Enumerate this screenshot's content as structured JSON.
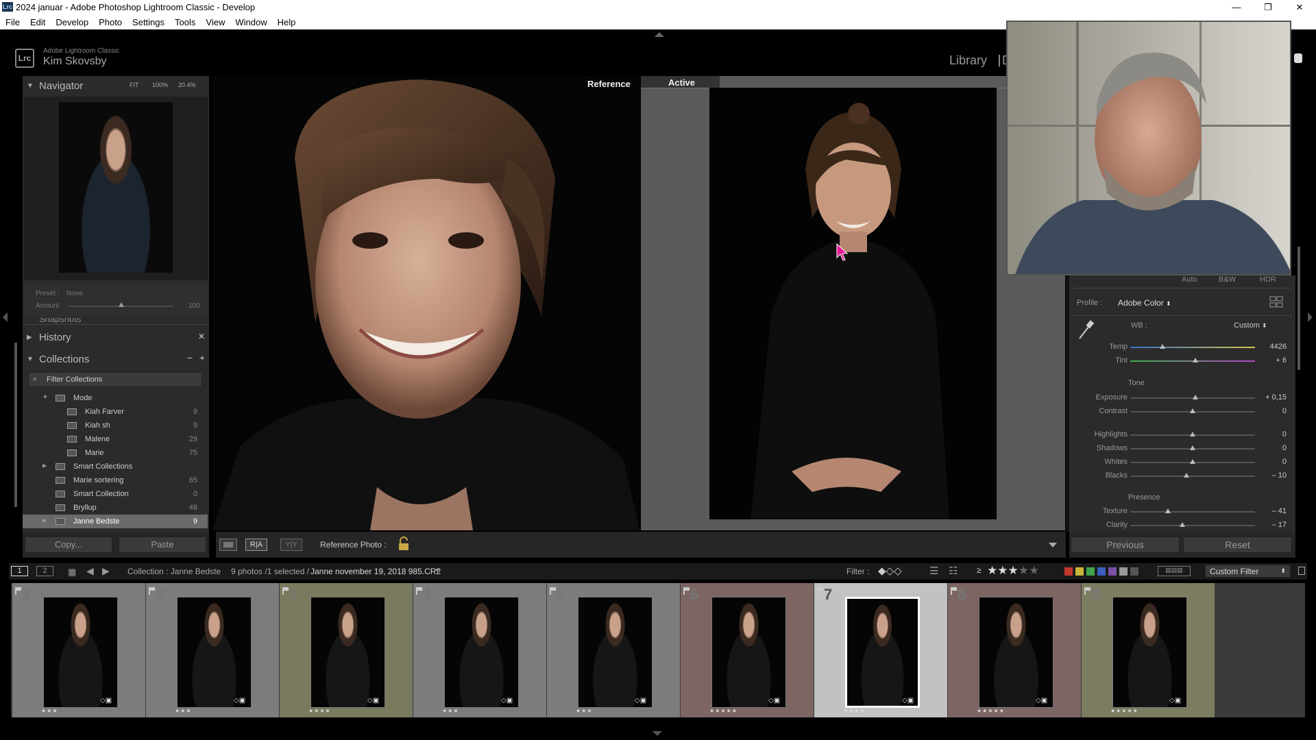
{
  "window": {
    "title": "2024 januar - Adobe Photoshop Lightroom Classic - Develop",
    "app_icon": "Lrc"
  },
  "menu": [
    "File",
    "Edit",
    "Develop",
    "Photo",
    "Settings",
    "Tools",
    "View",
    "Window",
    "Help"
  ],
  "identity": {
    "product": "Adobe Lightroom Classic",
    "user": "Kim Skovsby",
    "logo": "Lrc",
    "module": "Library",
    "module_partial": "D"
  },
  "navigator": {
    "title": "Navigator",
    "fit": "FIT",
    "zoom1": "100%",
    "zoom2": "20.4%"
  },
  "preset": {
    "label": "Preset :",
    "value": "None",
    "amount_label": "Amount",
    "amount_value": "100",
    "amount_fraction": 0.5
  },
  "panels": {
    "snapshots": "Snapshots",
    "history": "History",
    "collections": "Collections"
  },
  "collections": {
    "filter": "Filter Collections",
    "items": [
      {
        "name": "Mode",
        "count": ""
      },
      {
        "name": "Kiah Farver",
        "count": "9"
      },
      {
        "name": "Kiah sh",
        "count": "9"
      },
      {
        "name": "Malene",
        "count": "29"
      },
      {
        "name": "Marie",
        "count": "75"
      },
      {
        "name": "Smart Collections",
        "count": ""
      },
      {
        "name": "Marie sortering",
        "count": "65"
      },
      {
        "name": "Smart Collection",
        "count": "0"
      },
      {
        "name": "Bryllup",
        "count": "48"
      },
      {
        "name": "Janne Bedste",
        "count": "9"
      }
    ]
  },
  "left_buttons": {
    "copy": "Copy...",
    "paste": "Paste"
  },
  "compare": {
    "reference_label": "Reference",
    "active_label": "Active",
    "reference_photo": "Reference Photo :",
    "view_ra": "R|A",
    "view_yy": "Y|Y"
  },
  "basic": {
    "tabs": [
      "Auto",
      "B&W",
      "HDR"
    ],
    "profile_label": "Profile :",
    "profile_value": "Adobe Color",
    "wb_label": "WB :",
    "wb_value": "Custom",
    "tone_label": "Tone",
    "presence_label": "Presence",
    "sliders": [
      {
        "label": "Temp",
        "value": "4426",
        "fraction": 0.26
      },
      {
        "label": "Tint",
        "value": "+ 6",
        "fraction": 0.52
      },
      {
        "label": "Exposure",
        "value": "+ 0,15",
        "fraction": 0.52
      },
      {
        "label": "Contrast",
        "value": "0",
        "fraction": 0.5
      },
      {
        "label": "Highlights",
        "value": "0",
        "fraction": 0.5
      },
      {
        "label": "Shadows",
        "value": "0",
        "fraction": 0.5
      },
      {
        "label": "Whites",
        "value": "0",
        "fraction": 0.5
      },
      {
        "label": "Blacks",
        "value": "– 10",
        "fraction": 0.45
      },
      {
        "label": "Texture",
        "value": "– 41",
        "fraction": 0.3
      },
      {
        "label": "Clarity",
        "value": "– 17",
        "fraction": 0.42
      }
    ],
    "previous": "Previous",
    "reset": "Reset"
  },
  "filmbar": {
    "page1": "1",
    "page2": "2",
    "source": "Collection : Janne Bedste",
    "count": "9 photos /1 selected /",
    "file": "Janne november 19, 2018 985.CR2",
    "filter_label": "Filter :",
    "rating_op": "≥",
    "rating_stars": 3,
    "custom_filter": "Custom Filter"
  },
  "label_colors": [
    "#c0392b",
    "#c9b43a",
    "#3fa34d",
    "#3a5fbf",
    "#7b4fa8",
    "#999999",
    "#555555"
  ],
  "filmstrip": [
    {
      "n": "1",
      "stars": "★★★",
      "bg": "#7c7c7c"
    },
    {
      "n": "2",
      "stars": "★★★",
      "bg": "#7c7c7c"
    },
    {
      "n": "3",
      "stars": "★★★★",
      "bg": "#7a7a5e"
    },
    {
      "n": "4",
      "stars": "★★★",
      "bg": "#7c7c7c"
    },
    {
      "n": "5",
      "stars": "★★★",
      "bg": "#7c7c7c"
    },
    {
      "n": "6",
      "stars": "★★★★★",
      "bg": "#7c6562"
    },
    {
      "n": "7",
      "stars": "★★★★·",
      "bg": "#c2c2c2"
    },
    {
      "n": "8",
      "stars": "★★★★★",
      "bg": "#7c6562"
    },
    {
      "n": "9",
      "stars": "★★★★★",
      "bg": "#7c7c60"
    }
  ],
  "icons": {
    "close": "✕",
    "minimize": "—",
    "maximize": "❐",
    "lock": "lock-icon",
    "eyedropper": "eyedropper-icon",
    "search": "search-icon"
  }
}
